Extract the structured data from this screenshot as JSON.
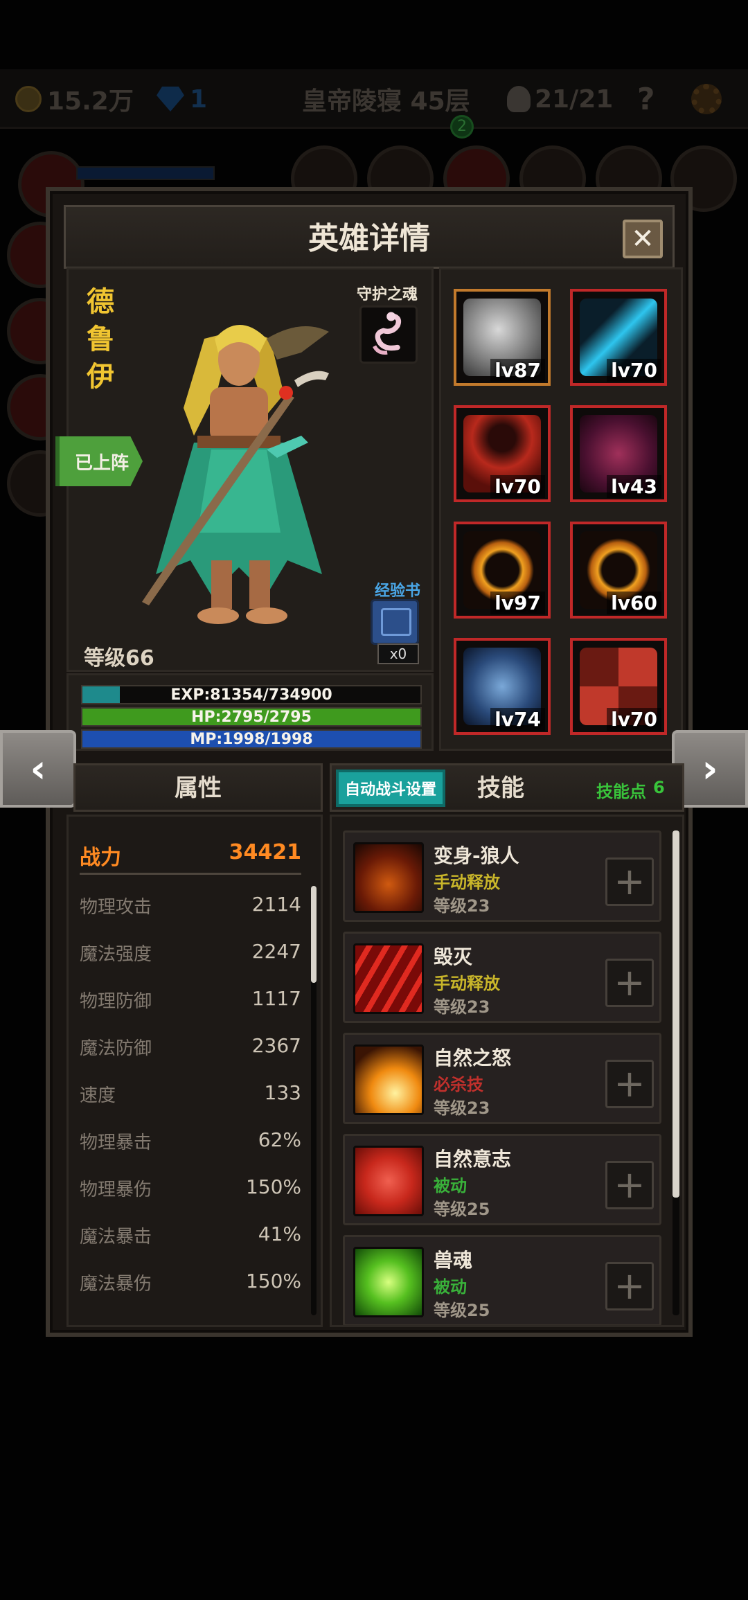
{
  "topbar": {
    "gold": "15.2万",
    "gems": "1",
    "location": "皇帝陵寝 45层",
    "kills": "21/21",
    "help": "?",
    "badge": "2"
  },
  "dialog": {
    "title": "英雄详情",
    "close": "✕"
  },
  "hero": {
    "name_chars": [
      "德",
      "鲁",
      "伊"
    ],
    "soul_label": "守护之魂",
    "exp_book_label": "经验书",
    "exp_book_count": "x0",
    "level": "等级66",
    "deployed": "已上阵"
  },
  "bars": {
    "exp": {
      "text": "EXP:81354/734900",
      "value": 81354,
      "max": 734900,
      "color": "#1e8a8c"
    },
    "hp": {
      "text": "HP:2795/2795",
      "value": 2795,
      "max": 2795,
      "color": "#3f9a1e"
    },
    "mp": {
      "text": "MP:1998/1998",
      "value": 1998,
      "max": 1998,
      "color": "#1d4fb0"
    }
  },
  "equipment": [
    {
      "level": "lv87",
      "icon": "helmet-icon",
      "frame": "gold"
    },
    {
      "level": "lv70",
      "icon": "amulet-icon",
      "frame": "red"
    },
    {
      "level": "lv70",
      "icon": "cape-icon",
      "frame": "red"
    },
    {
      "level": "lv43",
      "icon": "gauntlet-icon",
      "frame": "red"
    },
    {
      "level": "lv97",
      "icon": "ring-icon",
      "frame": "red"
    },
    {
      "level": "lv60",
      "icon": "ring-icon",
      "frame": "red"
    },
    {
      "level": "lv74",
      "icon": "axe-icon",
      "frame": "red"
    },
    {
      "level": "lv70",
      "icon": "shield-icon",
      "frame": "red"
    }
  ],
  "nav": {
    "prev": "‹",
    "next": "›"
  },
  "attributes": {
    "title": "属性",
    "power_label": "战力",
    "power_value": "34421",
    "rows": [
      {
        "label": "物理攻击",
        "value": "2114"
      },
      {
        "label": "魔法强度",
        "value": "2247"
      },
      {
        "label": "物理防御",
        "value": "1117"
      },
      {
        "label": "魔法防御",
        "value": "2367"
      },
      {
        "label": "速度",
        "value": "133"
      },
      {
        "label": "物理暴击",
        "value": "62%"
      },
      {
        "label": "物理暴伤",
        "value": "150%"
      },
      {
        "label": "魔法暴击",
        "value": "41%"
      },
      {
        "label": "魔法暴伤",
        "value": "150%"
      }
    ]
  },
  "skills": {
    "auto_battle": "自动战斗设置",
    "title": "技能",
    "points_label": "技能点",
    "points_value": "6",
    "list": [
      {
        "name": "变身-狼人",
        "type": "手动释放",
        "type_color": "#c9b62a",
        "level": "等级23",
        "icon": "werewolf-icon"
      },
      {
        "name": "毁灭",
        "type": "手动释放",
        "type_color": "#c9b62a",
        "level": "等级23",
        "icon": "claw-icon"
      },
      {
        "name": "自然之怒",
        "type": "必杀技",
        "type_color": "#c0302c",
        "level": "等级23",
        "icon": "fire-icon"
      },
      {
        "name": "自然意志",
        "type": "被动",
        "type_color": "#39b13a",
        "level": "等级25",
        "icon": "paw-icon"
      },
      {
        "name": "兽魂",
        "type": "被动",
        "type_color": "#39b13a",
        "level": "等级25",
        "icon": "spirit-icon"
      }
    ]
  }
}
